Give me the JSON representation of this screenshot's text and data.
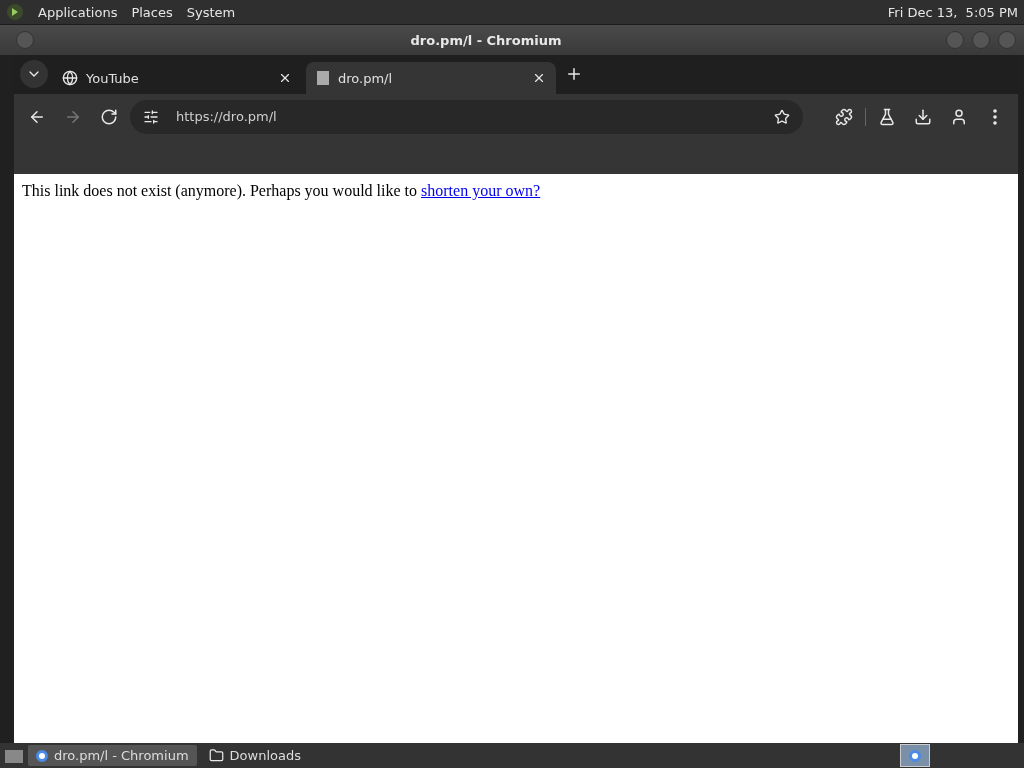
{
  "top_panel": {
    "menus": [
      "Applications",
      "Places",
      "System"
    ],
    "clock": "Fri Dec 13,  5:05 PM"
  },
  "window": {
    "title": "dro.pm/l - Chromium"
  },
  "tabs": [
    {
      "label": "YouTube",
      "selected": false
    },
    {
      "label": "dro.pm/l",
      "selected": true
    }
  ],
  "address_bar": {
    "value": "https://dro.pm/l"
  },
  "page": {
    "text": "This link does not exist (anymore). Perhaps you would like to ",
    "link": "shorten your own?"
  },
  "taskbar": {
    "items": [
      {
        "label": "dro.pm/l - Chromium",
        "kind": "browser",
        "selected": true
      },
      {
        "label": "Downloads",
        "kind": "folder",
        "selected": false
      }
    ]
  }
}
